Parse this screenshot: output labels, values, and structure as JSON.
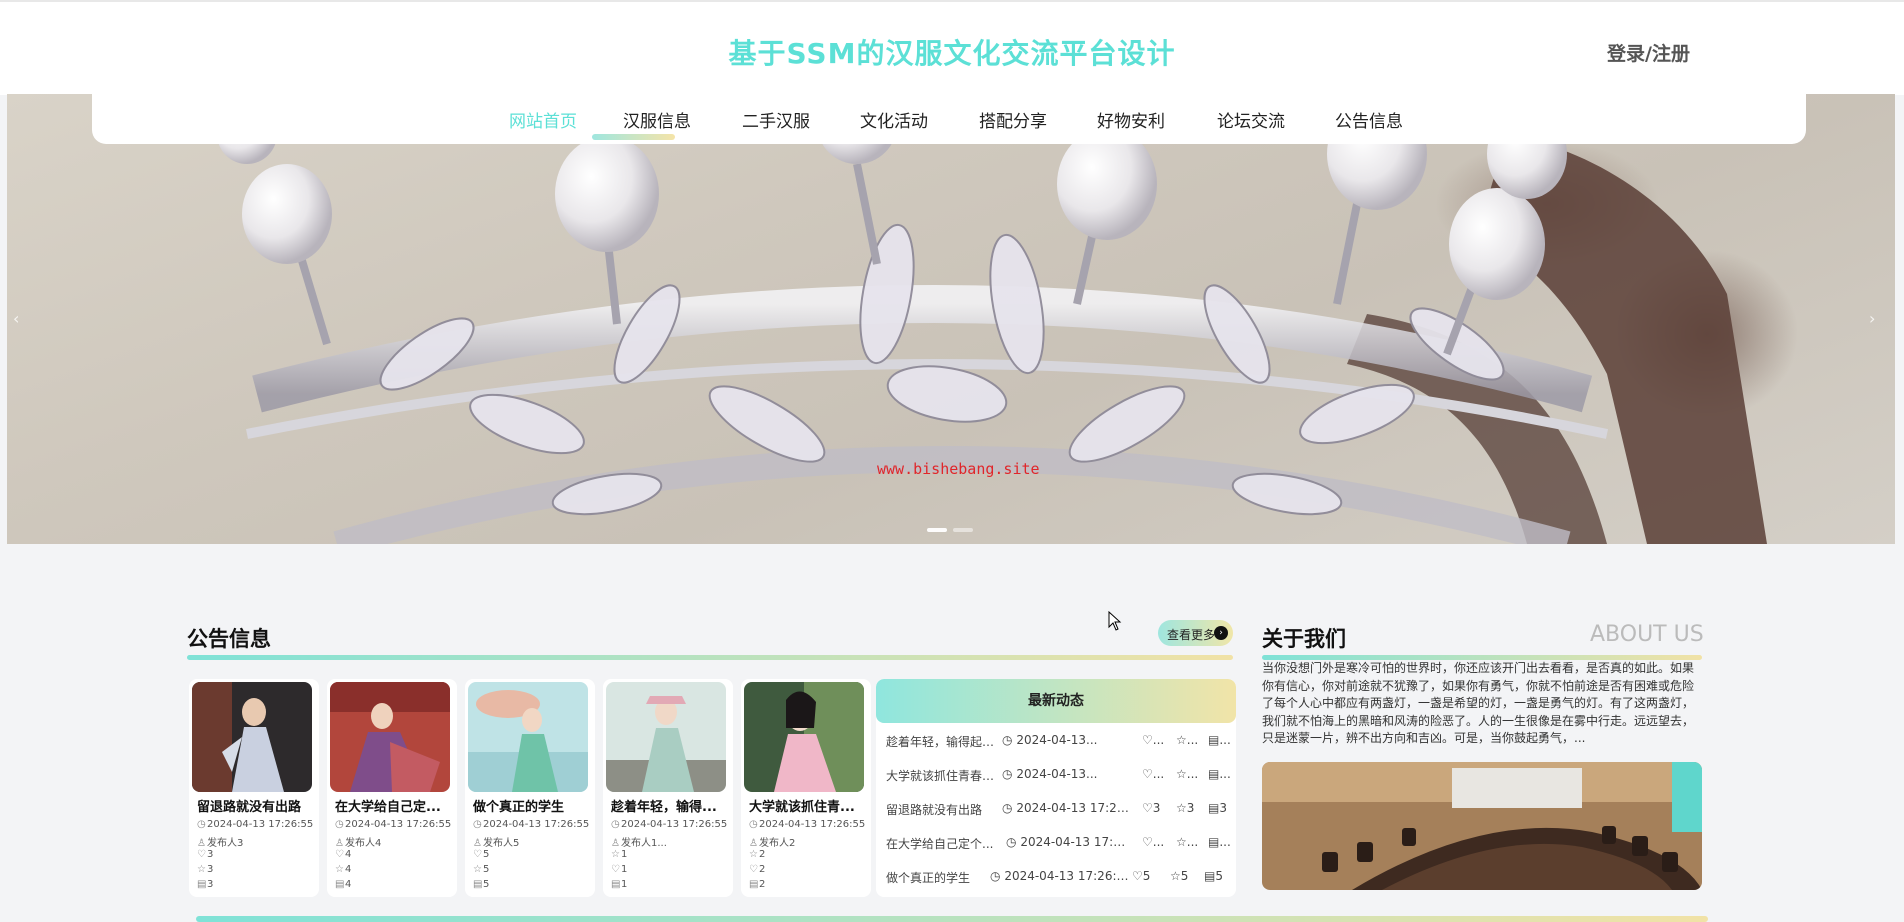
{
  "header": {
    "site_title": "基于SSM的汉服文化交流平台设计",
    "login_label": "登录/注册"
  },
  "nav": {
    "items": [
      {
        "label": "网站首页",
        "active": true
      },
      {
        "label": "汉服信息"
      },
      {
        "label": "二手汉服"
      },
      {
        "label": "文化活动"
      },
      {
        "label": "搭配分享"
      },
      {
        "label": "好物安利"
      },
      {
        "label": "论坛交流"
      },
      {
        "label": "公告信息"
      }
    ]
  },
  "banner": {
    "watermark": "www.bishebang.site",
    "prev_arrow": "‹",
    "next_arrow": "›"
  },
  "notice": {
    "title": "公告信息",
    "more_label": "查看更多",
    "cards": [
      {
        "title": "留退路就没有出路",
        "time": "2024-04-13 17:26:55",
        "author": "发布人3",
        "c1": "3",
        "c2": "3",
        "c3": "3"
      },
      {
        "title": "在大学给自己定...",
        "time": "2024-04-13 17:26:55",
        "author": "发布人4",
        "c1": "4",
        "c2": "4",
        "c3": "4"
      },
      {
        "title": "做个真正的学生",
        "time": "2024-04-13 17:26:55",
        "author": "发布人5",
        "c1": "5",
        "c2": "5",
        "c3": "5"
      },
      {
        "title": "趁着年轻，输得...",
        "time": "2024-04-13 17:26:55",
        "author": "发布人1...",
        "c1": "1",
        "c2": "1",
        "c3": "1"
      },
      {
        "title": "大学就该抓住青...",
        "time": "2024-04-13 17:26:55",
        "author": "发布人2",
        "c1": "2",
        "c2": "2",
        "c3": "2"
      }
    ]
  },
  "news": {
    "title": "最新动态",
    "rows": [
      {
        "title": "趁着年轻，输得起，看...",
        "time": "2024-04-13...",
        "c1": "...",
        "c2": "...",
        "c3": "..."
      },
      {
        "title": "大学就该抓住青春，用...",
        "time": "2024-04-13...",
        "c1": "...",
        "c2": "...",
        "c3": "..."
      },
      {
        "title": "留退路就没有出路",
        "time": "2024-04-13 17:26:55",
        "c1": "3",
        "c2": "3",
        "c3": "3"
      },
      {
        "title": "在大学给自己定个...",
        "time": "2024-04-13 17:2...",
        "c1": "...",
        "c2": "...",
        "c3": "..."
      },
      {
        "title": "做个真正的学生",
        "time": "2024-04-13 17:26:55",
        "c1": "5",
        "c2": "5",
        "c3": "5"
      }
    ]
  },
  "about": {
    "title": "关于我们",
    "title_en": "ABOUT US",
    "text": "当你没想门外是寒冷可怕的世界时，你还应该开门出去看看，是否真的如此。如果你有信心，你对前途就不犹豫了，如果你有勇气，你就不怕前途是否有困难或危险了每个人心中都应有两盏灯，一盏是希望的灯，一盏是勇气的灯。有了这两盏灯，我们就不怕海上的黑暗和风涛的险恶了。人的一生很像是在雾中行走。远远望去，只是迷蒙一片，辨不出方向和吉凶。可是，当你鼓起勇气，..."
  },
  "icons": {
    "clock": "◷",
    "user": "♙",
    "like": "♡",
    "star": "☆",
    "view": "▤"
  },
  "colors": {
    "accent": "#5ce0d6",
    "gradient_start": "#7fe2d7",
    "gradient_end": "#f1e2a6",
    "watermark": "#e0262a"
  }
}
